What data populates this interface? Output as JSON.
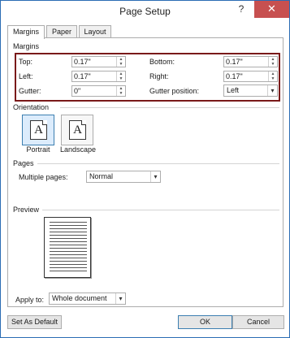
{
  "window": {
    "title": "Page Setup",
    "help": "?",
    "close": "✕"
  },
  "tabs": [
    {
      "label": "Margins",
      "active": true
    },
    {
      "label": "Paper",
      "active": false
    },
    {
      "label": "Layout",
      "active": false
    }
  ],
  "margins": {
    "section_label": "Margins",
    "top_label": "Top:",
    "top_value": "0.17\"",
    "left_label": "Left:",
    "left_value": "0.17\"",
    "gutter_label": "Gutter:",
    "gutter_value": "0\"",
    "bottom_label": "Bottom:",
    "bottom_value": "0.17\"",
    "right_label": "Right:",
    "right_value": "0.17\"",
    "gutter_position_label": "Gutter position:",
    "gutter_position_value": "Left"
  },
  "orientation": {
    "section_label": "Orientation",
    "portrait_label": "Portrait",
    "landscape_label": "Landscape",
    "icon_letter": "A",
    "selected": "Portrait"
  },
  "pages": {
    "section_label": "Pages",
    "multiple_pages_label": "Multiple pages:",
    "multiple_pages_value": "Normal"
  },
  "preview": {
    "section_label": "Preview"
  },
  "apply_to": {
    "label": "Apply to:",
    "value": "Whole document"
  },
  "buttons": {
    "set_default": "Set As Default",
    "ok": "OK",
    "cancel": "Cancel"
  },
  "colors": {
    "highlight_box": "#7a1a1a",
    "close_button": "#c75050",
    "window_border": "#2b6cb4"
  }
}
